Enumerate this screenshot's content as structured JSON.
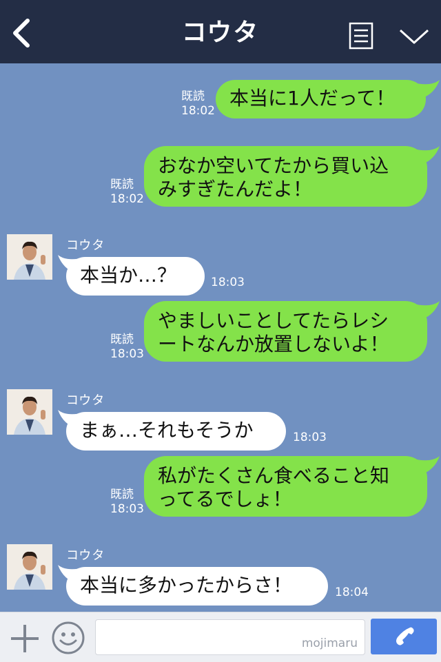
{
  "header": {
    "title": "コウタ"
  },
  "messages": [
    {
      "side": "me",
      "text_lines": [
        "本当に1人だって！"
      ],
      "read": "既読",
      "time": "18:02"
    },
    {
      "side": "me",
      "text_lines": [
        "おなか空いてたから買い込",
        "みすぎたんだよ！"
      ],
      "read": "既読",
      "time": "18:02"
    },
    {
      "side": "them",
      "sender": "コウタ",
      "text_lines": [
        "本当か…？"
      ],
      "time": "18:03"
    },
    {
      "side": "me",
      "text_lines": [
        "やましいことしてたらレシ",
        "ートなんか放置しないよ！"
      ],
      "read": "既読",
      "time": "18:03"
    },
    {
      "side": "them",
      "sender": "コウタ",
      "text_lines": [
        "まぁ…それもそうか"
      ],
      "time": "18:03"
    },
    {
      "side": "me",
      "text_lines": [
        "私がたくさん食べること知",
        "ってるでしょ！"
      ],
      "read": "既読",
      "time": "18:03"
    },
    {
      "side": "them",
      "sender": "コウタ",
      "text_lines": [
        "本当に多かったからさ！"
      ],
      "time": "18:04"
    }
  ],
  "input": {
    "placeholder": "",
    "watermark": "mojimaru"
  },
  "icons": {
    "back": "chevron-left-icon",
    "menu": "note-icon",
    "collapse": "chevron-down-icon",
    "add": "plus-icon",
    "emoji": "smiley-icon",
    "send": "phone-icon"
  },
  "colors": {
    "header": "#232d45",
    "background": "#7191c1",
    "my_bubble": "#84e24a",
    "their_bubble": "#ffffff",
    "send_button": "#4f82e3"
  }
}
